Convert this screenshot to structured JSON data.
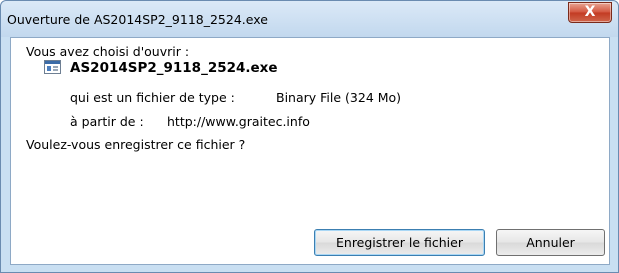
{
  "window": {
    "title": "Ouverture de AS2014SP2_9118_2524.exe",
    "close_glyph": "X"
  },
  "dialog": {
    "intro": "Vous avez choisi d'ouvrir :",
    "file_icon": "executable-file-icon",
    "file_name": "AS2014SP2_9118_2524.exe",
    "type_label": "qui est un fichier de type :",
    "type_value": "Binary File (324 Mo)",
    "source_label": "à partir de :",
    "source_value": "http://www.graitec.info",
    "question": "Voulez-vous enregistrer ce fichier ?"
  },
  "buttons": {
    "save": "Enregistrer le fichier",
    "cancel": "Annuler"
  },
  "colors": {
    "frame": "#c9dff2",
    "close_button": "#c23a22",
    "default_button_border": "#3c7fb1"
  }
}
